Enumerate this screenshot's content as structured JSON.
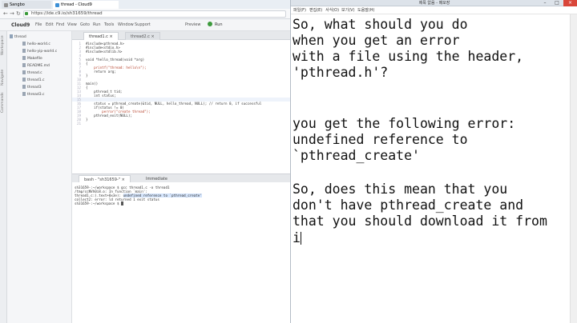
{
  "browser": {
    "tabs": [
      {
        "label": "Sangbo",
        "favicon_color": "#8e8e8e"
      },
      {
        "label": "thread - Cloud9",
        "favicon_color": "#3b8fd6"
      }
    ],
    "url": "https://ide.c9.io/sh31659/thread"
  },
  "ide": {
    "logo": "Cloud9",
    "menus": [
      "File",
      "Edit",
      "Find",
      "View",
      "Goto",
      "Run",
      "Tools",
      "Window",
      "Support"
    ],
    "preview_label": "Preview",
    "run_label": "Run",
    "side_labels": [
      "Workspace",
      "Navigate",
      "Commands"
    ],
    "folder": "thread",
    "files": [
      "hello-world.c",
      "hello-yip-world.c",
      "Makefile",
      "README.md",
      "thread.c",
      "thread1.c",
      "thread3",
      "thread3.c"
    ],
    "editor_tabs": [
      "thread1.c",
      "thread2.c"
    ],
    "line_numbers": [
      "1",
      "2",
      "3",
      "4",
      "5",
      "6",
      "7",
      "8",
      "9",
      "10",
      "11",
      "12",
      "13",
      "14",
      "15",
      "16",
      "17",
      "18",
      "19",
      "20",
      "21"
    ],
    "code": [
      "#include<pthread.h>",
      "#include<stdio.h>",
      "#include<stdlib.h>",
      "",
      "void *hello_thread(void *arg)",
      "{",
      "    printf(\"thread: hello\\n\");",
      "    return arg;",
      "}",
      "",
      "main()",
      "{",
      "    pthread_t tid;",
      "    int status;",
      "",
      "    status = pthread_create(&tid, NULL, hello_thread, NULL); // return 0, if successful",
      "    if(status != 0)",
      "        perror(\"create thread\");",
      "    pthread_exit(NULL);",
      "}",
      ""
    ],
    "console_tabs": [
      "bash - \"sh31659-\"",
      "Immediate"
    ],
    "console_lines": [
      "sh31659-:~/workspace $ gcc thread1.c -o thread1",
      "/tmp/ccNVh0i8.o: In function `main':",
      "thread1.c:(.text+0x3e): ",
      "collect2: error: ld returned 1 exit status",
      "sh31659-:~/workspace $ "
    ],
    "console_error_highlight": "undefined reference to `pthread_create'"
  },
  "notepad": {
    "title": "제목 없음 - 메모장",
    "menus": [
      "파일(F)",
      "편집(E)",
      "서식(O)",
      "보기(V)",
      "도움말(H)"
    ],
    "lines": [
      "So, what should you do",
      "when you get an error",
      "with a file using the header,",
      "'pthread.h'?",
      "",
      "",
      "you get the following error:",
      "undefined reference to",
      "`pthread_create'",
      "",
      "So, does this mean that you",
      "don't have pthread_create and",
      "that you should download it from",
      "i"
    ]
  }
}
